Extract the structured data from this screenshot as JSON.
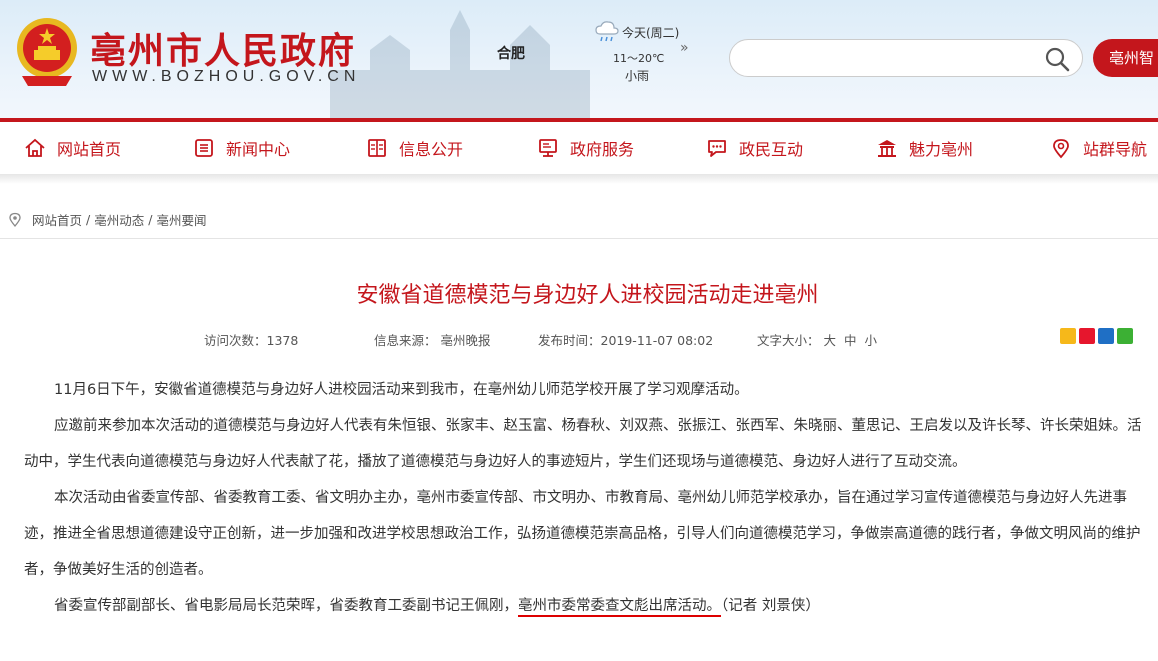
{
  "header": {
    "site_name": "亳州市人民政府",
    "site_url": "WWW.BOZHOU.GOV.CN",
    "city": "合肥",
    "weather": {
      "day": "今天(周二)",
      "temp": "11～20℃",
      "condition": "小雨",
      "more": "»"
    },
    "search": {
      "value": "",
      "placeholder": ""
    },
    "smart_button": "亳州智"
  },
  "nav": [
    {
      "label": "网站首页",
      "icon": "home-icon"
    },
    {
      "label": "新闻中心",
      "icon": "news-icon"
    },
    {
      "label": "信息公开",
      "icon": "book-icon"
    },
    {
      "label": "政府服务",
      "icon": "service-icon"
    },
    {
      "label": "政民互动",
      "icon": "chat-icon"
    },
    {
      "label": "魅力亳州",
      "icon": "pavilion-icon"
    },
    {
      "label": "站群导航",
      "icon": "location-pin-icon"
    }
  ],
  "breadcrumb": [
    "网站首页",
    "亳州动态",
    "亳州要闻"
  ],
  "article": {
    "title": "安徽省道德模范与身边好人进校园活动走进亳州",
    "meta": {
      "visits": "访问次数：1378",
      "source": "信息来源：  亳州晚报",
      "time": "发布时间：2019-11-07 08:02",
      "font_size_label": "文字大小：",
      "font_sizes": [
        "大",
        "中",
        "小"
      ]
    },
    "share_icons": [
      "qzone-icon",
      "weibo-icon",
      "renren-icon",
      "wechat-icon"
    ],
    "paragraphs": [
      "11月6日下午，安徽省道德模范与身边好人进校园活动来到我市，在亳州幼儿师范学校开展了学习观摩活动。",
      "应邀前来参加本次活动的道德模范与身边好人代表有朱恒银、张家丰、赵玉富、杨春秋、刘双燕、张振江、张西军、朱晓丽、董思记、王启发以及许长琴、许长荣姐妹。活动中，学生代表向道德模范与身边好人代表献了花，播放了道德模范与身边好人的事迹短片，学生们还现场与道德模范、身边好人进行了互动交流。",
      "本次活动由省委宣传部、省委教育工委、省文明办主办，亳州市委宣传部、市文明办、市教育局、亳州幼儿师范学校承办，旨在通过学习宣传道德模范与身边好人先进事迹，推进全省思想道德建设守正创新，进一步加强和改进学校思想政治工作，弘扬道德模范崇高品格，引导人们向道德模范学习，争做崇高道德的践行者，争做文明风尚的维护者，争做美好生活的创造者。"
    ],
    "last_paragraph": {
      "before": "省委宣传部副部长、省电影局局长范荣晖，省委教育工委副书记王佩刚，",
      "underlined": "亳州市委常委查文彪出席活动。",
      "after": "（记者 刘景侠）"
    }
  },
  "colors": {
    "brand_red": "#c4161c",
    "underline": "#dd0000"
  }
}
